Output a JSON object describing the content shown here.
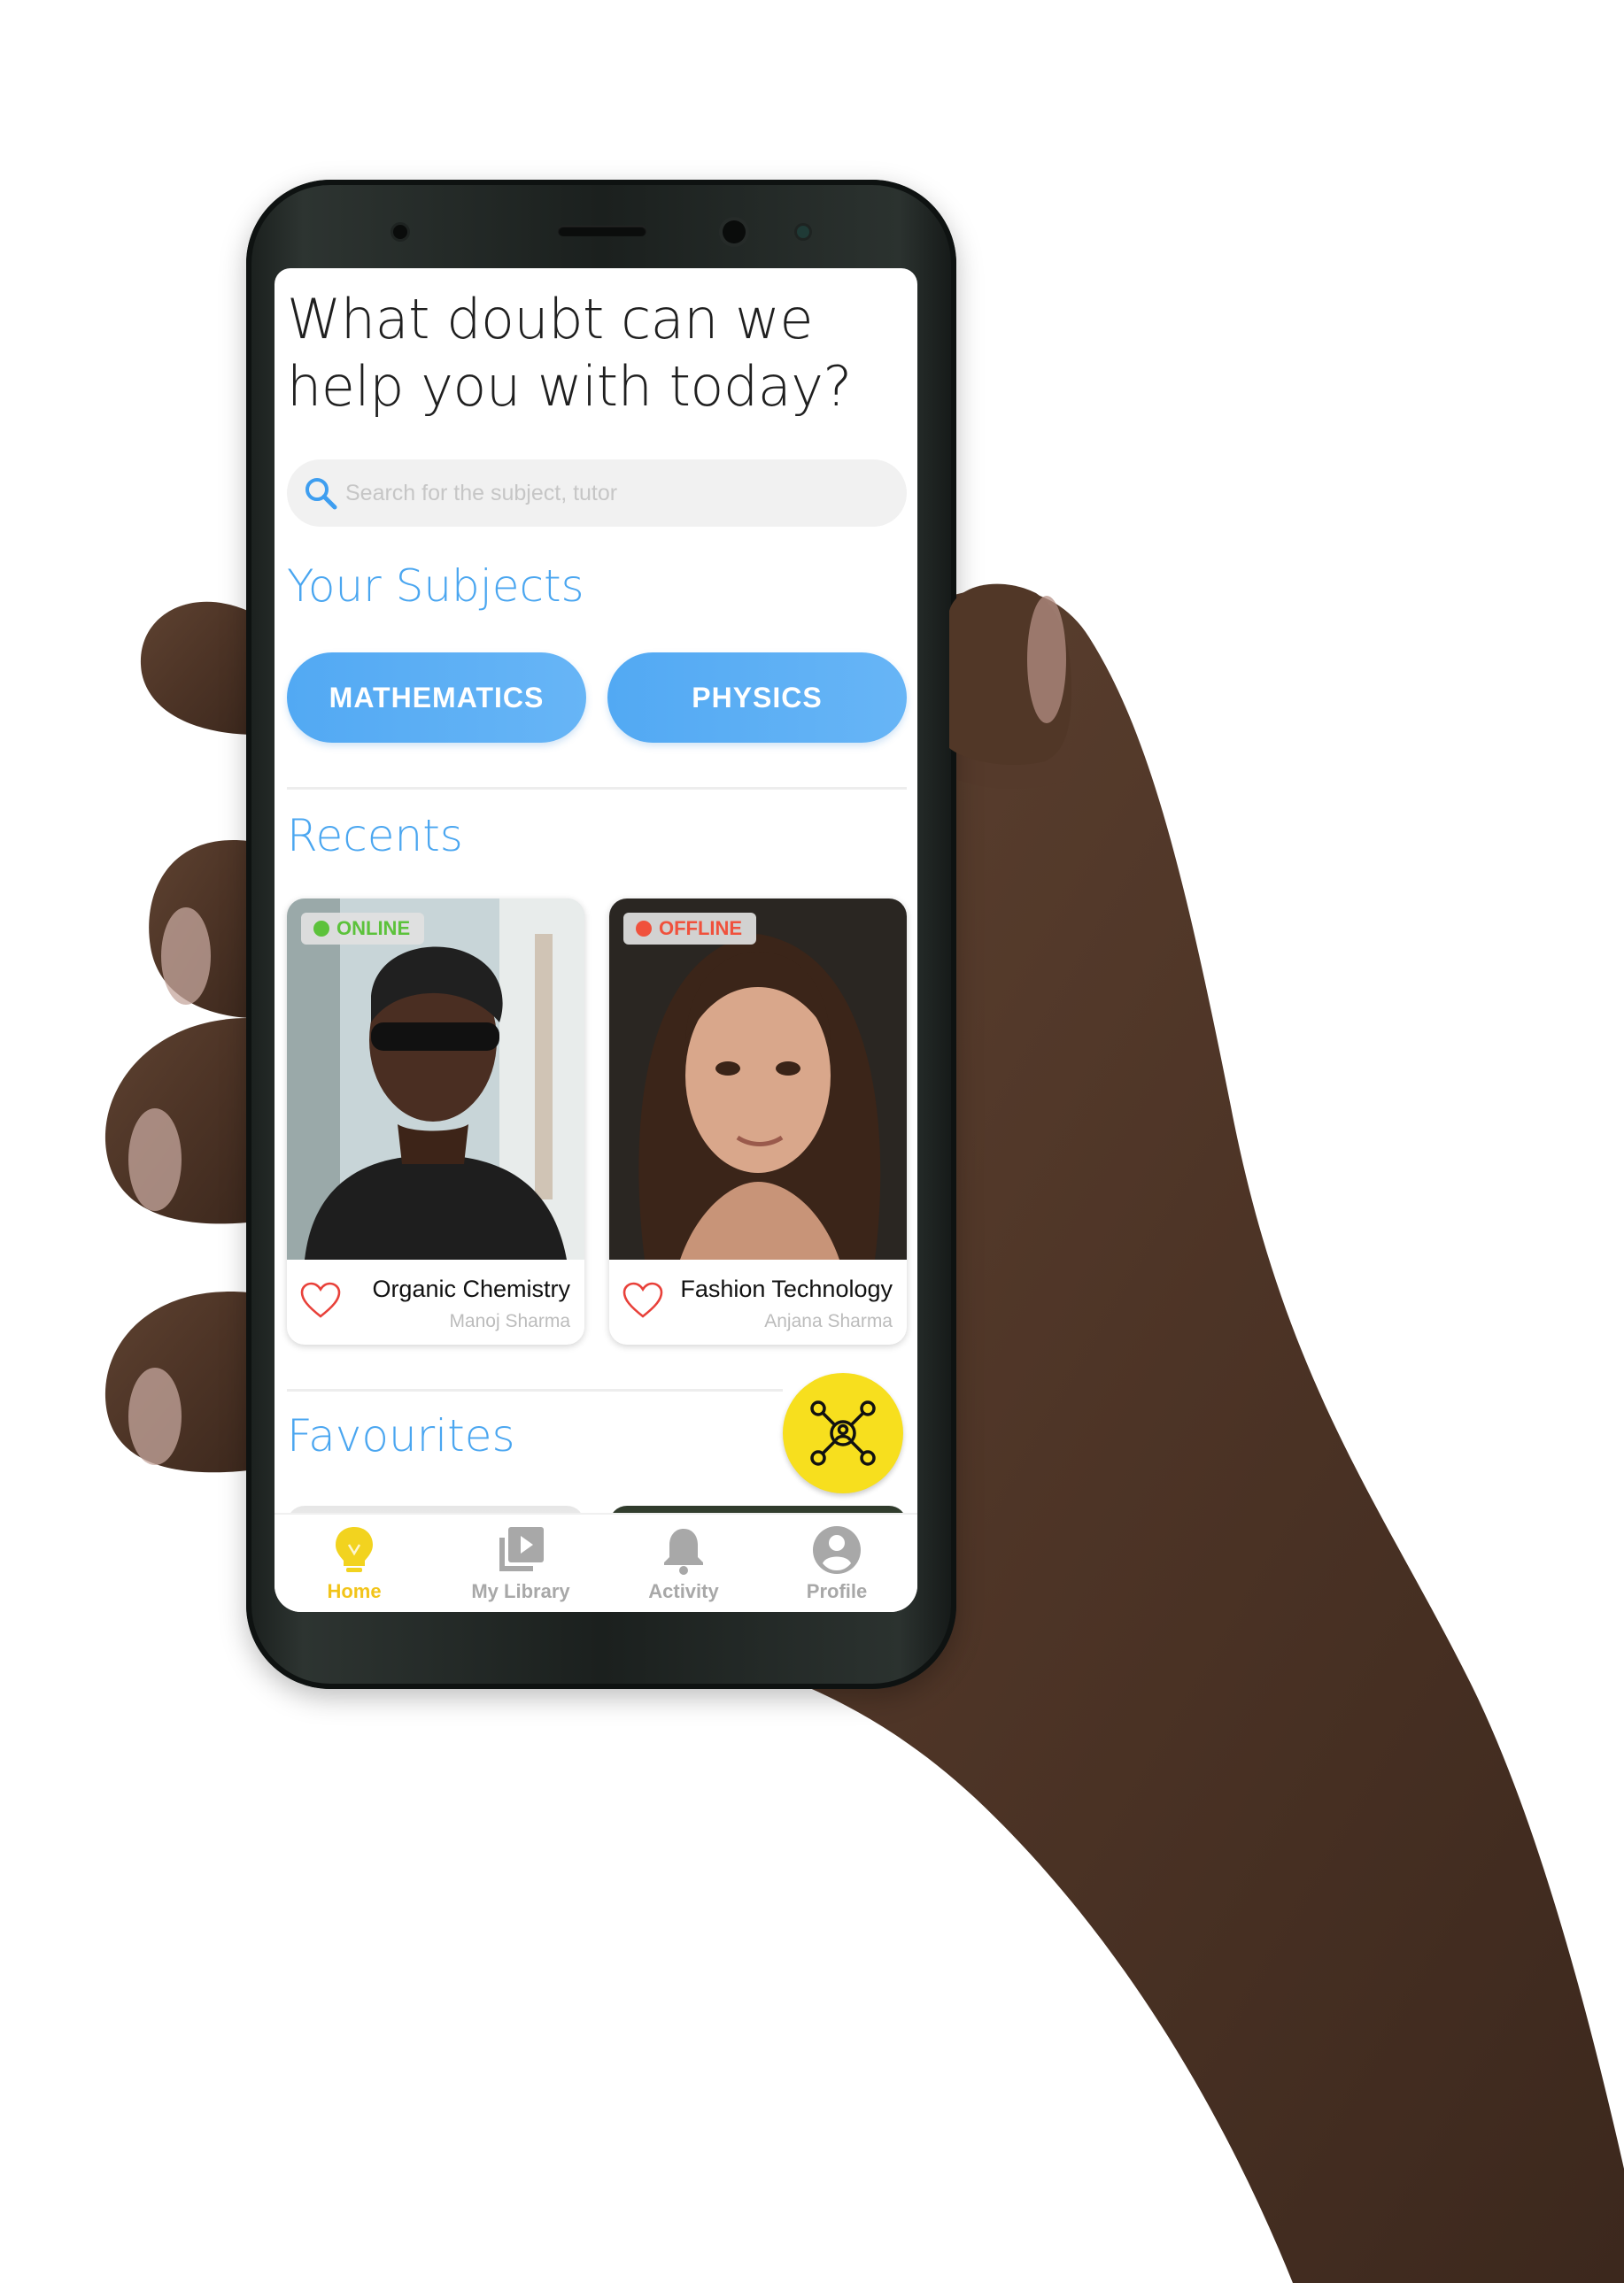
{
  "screen": {
    "headline": "What doubt can we help you with today?",
    "search": {
      "placeholder": "Search for the subject, tutor",
      "icon": "search-icon"
    },
    "subjects": {
      "title": "Your Subjects",
      "items": [
        {
          "label": "MATHEMATICS"
        },
        {
          "label": "PHYSICS"
        }
      ]
    },
    "recents": {
      "title": "Recents",
      "cards": [
        {
          "status": "ONLINE",
          "status_color": "#5cc23b",
          "subject": "Organic Chemistry",
          "tutor": "Manoj Sharma"
        },
        {
          "status": "OFFLINE",
          "status_color": "#f0513c",
          "subject": "Fashion Technology",
          "tutor": "Anjana Sharma"
        }
      ]
    },
    "favourites": {
      "title": "Favourites"
    },
    "fab": {
      "icon": "network-connect-icon"
    },
    "nav": {
      "items": [
        {
          "label": "Home",
          "icon": "lightbulb-icon",
          "active": true
        },
        {
          "label": "My Library",
          "icon": "video-library-icon",
          "active": false
        },
        {
          "label": "Activity",
          "icon": "bell-icon",
          "active": false
        },
        {
          "label": "Profile",
          "icon": "account-circle-icon",
          "active": false
        }
      ]
    },
    "colors": {
      "accent_blue": "#4aa6f0",
      "accent_yellow": "#f7df1e",
      "nav_inactive": "#a8a8a8"
    }
  }
}
